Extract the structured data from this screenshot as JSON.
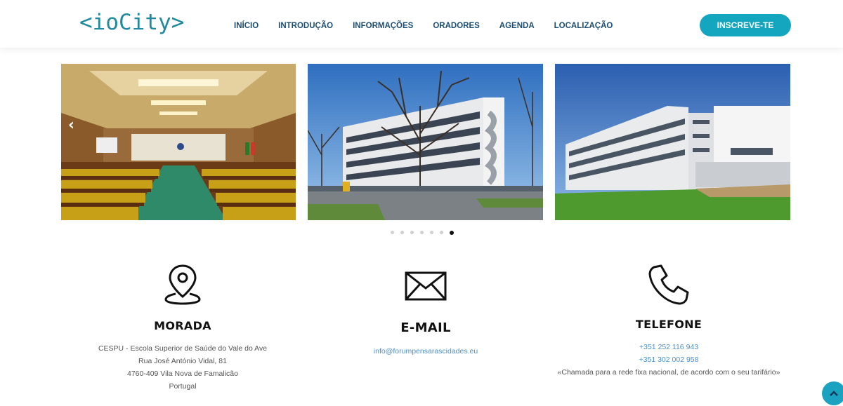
{
  "header": {
    "logo": "<ioCity>",
    "nav": [
      "INÍCIO",
      "INTRODUÇÃO",
      "INFORMAÇÕES",
      "ORADORES",
      "AGENDA",
      "LOCALIZAÇÃO"
    ],
    "cta": "INSCREVE-TE"
  },
  "carousel": {
    "prev_icon": "chevron-left-icon",
    "slides": [
      "auditorium",
      "building-with-tree",
      "building-front-lawn"
    ],
    "dots_count": 7,
    "active_dot": 7
  },
  "contact": {
    "address": {
      "icon": "location-pin-icon",
      "title": "MORADA",
      "lines": [
        "CESPU - Escola Superior de Saúde do Vale do Ave",
        "Rua José António Vidal, 81",
        "4760-409 Vila Nova de Famalicão",
        "Portugal"
      ]
    },
    "email": {
      "icon": "envelope-icon",
      "title": "E-MAIL",
      "address": "info@forumpensarascidades.eu"
    },
    "phone": {
      "icon": "phone-icon",
      "title": "TELEFONE",
      "numbers": [
        "+351 252 116 943",
        "+351 302 002 958"
      ],
      "note": "«Chamada para a rede fixa nacional, de acordo com o seu tarifário»"
    }
  },
  "scroll_top_icon": "chevron-up-icon",
  "colors": {
    "accent": "#14a5bf",
    "nav_text": "#1d4e72",
    "logo": "#1f8a9e",
    "link": "#4a8fc9"
  }
}
